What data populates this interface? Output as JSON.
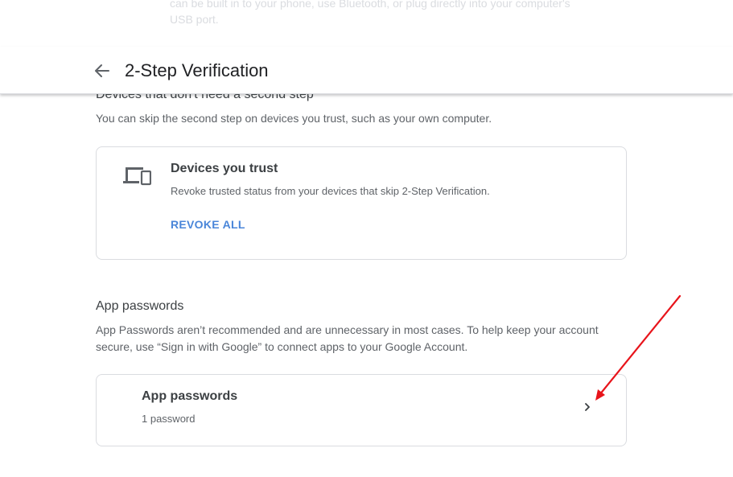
{
  "behind_header_text": "can be built in to your phone, use Bluetooth, or plug directly into your computer's USB port.",
  "header": {
    "title": "2-Step Verification",
    "back_icon": "arrow-back-icon"
  },
  "trusted_section": {
    "heading": "Devices that don't need a second step",
    "description": "You can skip the second step on devices you trust, such as your own computer.",
    "card": {
      "icon": "devices-icon",
      "title": "Devices you trust",
      "subtitle": "Revoke trusted status from your devices that skip 2-Step Verification.",
      "action_label": "REVOKE ALL"
    }
  },
  "app_passwords_section": {
    "heading": "App passwords",
    "description_line1": "App Passwords aren’t recommended and are unnecessary in most cases. To help keep your account",
    "description_line2": "secure, use “Sign in with Google” to connect apps to your Google Account.",
    "card": {
      "title": "App passwords",
      "subtitle": "1 password",
      "chevron_icon": "chevron-right-icon"
    }
  },
  "colors": {
    "accent_blue": "#4a86d9",
    "annotation_red": "#e8141b",
    "border": "#dadce0"
  }
}
